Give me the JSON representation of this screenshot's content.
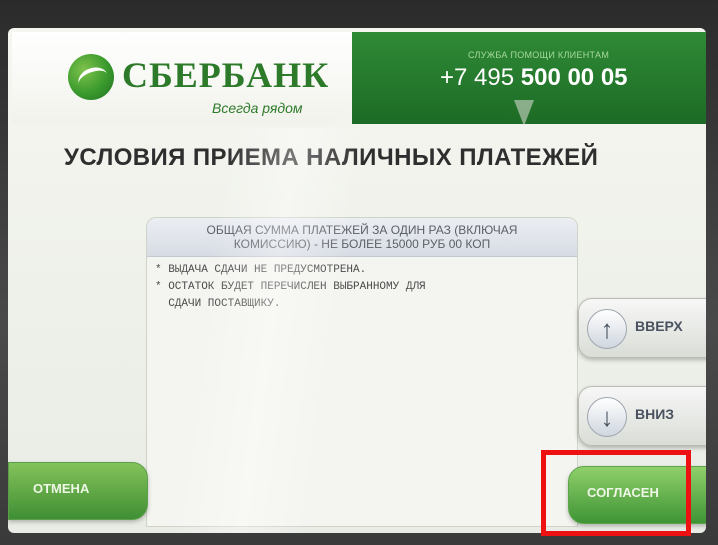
{
  "header": {
    "bank_name": "СБЕРБАНК",
    "slogan": "Всегда рядом",
    "helpline_caption": "СЛУЖБА ПОМОЩИ КЛИЕНТАМ",
    "helpline_prefix": "+7 495",
    "helpline_number": "500 00 05"
  },
  "main": {
    "title": "УСЛОВИЯ ПРИЕМА НАЛИЧНЫХ ПЛАТЕЖЕЙ",
    "info_header_line1": "ОБЩАЯ СУММА ПЛАТЕЖЕЙ ЗА ОДИН РАЗ (ВКЛЮЧАЯ",
    "info_header_line2": "КОМИССИЮ) - НЕ БОЛЕЕ 15000 РУБ 00 КОП",
    "info_lines": [
      "* ВЫДАЧА СДАЧИ НЕ ПРЕДУСМОТРЕНА.",
      "* ОСТАТОК БУДЕТ ПЕРЕЧИСЛЕН ВЫБРАННОМУ ДЛЯ",
      "  СДАЧИ ПОСТАВЩИКУ."
    ]
  },
  "buttons": {
    "up_label": "ВВЕРХ",
    "down_label": "ВНИЗ",
    "cancel_label": "ОТМЕНА",
    "agree_label": "СОГЛАСЕН"
  },
  "colors": {
    "brand_green": "#2d7a2a",
    "highlight_red": "#ee1111"
  },
  "icons": {
    "up": "arrow-up-icon",
    "down": "arrow-down-icon",
    "logo": "sberbank-logo-icon"
  }
}
